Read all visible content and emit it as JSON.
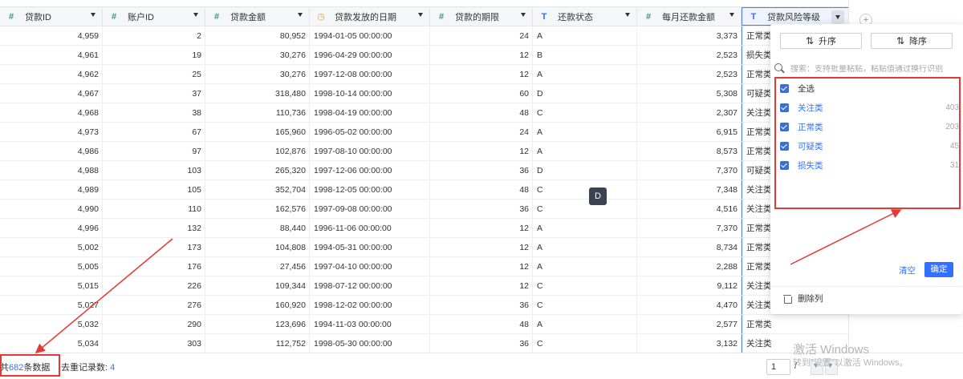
{
  "columns": [
    {
      "label": "贷款ID",
      "icon": "number-icon",
      "type": "num"
    },
    {
      "label": "账户ID",
      "icon": "number-icon",
      "type": "num"
    },
    {
      "label": "贷款金额",
      "icon": "number-icon",
      "type": "num"
    },
    {
      "label": "贷款发放的日期",
      "icon": "date-icon",
      "type": "date"
    },
    {
      "label": "贷款的期限",
      "icon": "number-icon",
      "type": "num"
    },
    {
      "label": "还款状态",
      "icon": "text-icon",
      "type": "txt"
    },
    {
      "label": "每月还款金额",
      "icon": "number-icon",
      "type": "num"
    },
    {
      "label": "贷款风险等级",
      "icon": "text-icon",
      "type": "txt"
    }
  ],
  "rows": [
    [
      "4,959",
      "2",
      "80,952",
      "1994-01-05 00:00:00",
      "24",
      "A",
      "3,373",
      "正常类"
    ],
    [
      "4,961",
      "19",
      "30,276",
      "1996-04-29 00:00:00",
      "12",
      "B",
      "2,523",
      "损失类"
    ],
    [
      "4,962",
      "25",
      "30,276",
      "1997-12-08 00:00:00",
      "12",
      "A",
      "2,523",
      "正常类"
    ],
    [
      "4,967",
      "37",
      "318,480",
      "1998-10-14 00:00:00",
      "60",
      "D",
      "5,308",
      "可疑类"
    ],
    [
      "4,968",
      "38",
      "110,736",
      "1998-04-19 00:00:00",
      "48",
      "C",
      "2,307",
      "关注类"
    ],
    [
      "4,973",
      "67",
      "165,960",
      "1996-05-02 00:00:00",
      "24",
      "A",
      "6,915",
      "正常类"
    ],
    [
      "4,986",
      "97",
      "102,876",
      "1997-08-10 00:00:00",
      "12",
      "A",
      "8,573",
      "正常类"
    ],
    [
      "4,988",
      "103",
      "265,320",
      "1997-12-06 00:00:00",
      "36",
      "D",
      "7,370",
      "可疑类"
    ],
    [
      "4,989",
      "105",
      "352,704",
      "1998-12-05 00:00:00",
      "48",
      "C",
      "7,348",
      "关注类"
    ],
    [
      "4,990",
      "110",
      "162,576",
      "1997-09-08 00:00:00",
      "36",
      "C",
      "4,516",
      "关注类"
    ],
    [
      "4,996",
      "132",
      "88,440",
      "1996-11-06 00:00:00",
      "12",
      "A",
      "7,370",
      "正常类"
    ],
    [
      "5,002",
      "173",
      "104,808",
      "1994-05-31 00:00:00",
      "12",
      "A",
      "8,734",
      "正常类"
    ],
    [
      "5,005",
      "176",
      "27,456",
      "1997-04-10 00:00:00",
      "12",
      "A",
      "2,288",
      "正常类"
    ],
    [
      "5,015",
      "226",
      "109,344",
      "1998-07-12 00:00:00",
      "12",
      "C",
      "9,112",
      "关注类"
    ],
    [
      "5,027",
      "276",
      "160,920",
      "1998-12-02 00:00:00",
      "36",
      "C",
      "4,470",
      "关注类"
    ],
    [
      "5,032",
      "290",
      "123,696",
      "1994-11-03 00:00:00",
      "48",
      "A",
      "2,577",
      "正常类"
    ],
    [
      "5,034",
      "303",
      "112,752",
      "1998-05-30 00:00:00",
      "36",
      "C",
      "3,132",
      "关注类"
    ]
  ],
  "tooltip": "D",
  "footer": {
    "total_prefix": "共",
    "total_count": "682",
    "total_suffix": "条数据",
    "dedup_label": "去重记录数:",
    "dedup_count": "4",
    "page_value": "1",
    "page_sep": "/"
  },
  "filter_panel": {
    "sort_asc": "升序",
    "sort_desc": "降序",
    "search_placeholder": "搜索：支持批量粘贴，粘贴值通过换行识别",
    "options": [
      {
        "label": "全选",
        "count": "",
        "checked": true,
        "blue": false
      },
      {
        "label": "关注类",
        "count": "403",
        "checked": true,
        "blue": true
      },
      {
        "label": "正常类",
        "count": "203",
        "checked": true,
        "blue": true
      },
      {
        "label": "可疑类",
        "count": "45",
        "checked": true,
        "blue": true
      },
      {
        "label": "损失类",
        "count": "31",
        "checked": true,
        "blue": true
      }
    ],
    "clear": "清空",
    "confirm": "确定",
    "delete_column": "删除列"
  },
  "watermark": {
    "line1": "激活 Windows",
    "line2": "转到\"设置\"以激活 Windows。"
  },
  "accent_color": "#3370ff",
  "annotation_color": "#e53935"
}
